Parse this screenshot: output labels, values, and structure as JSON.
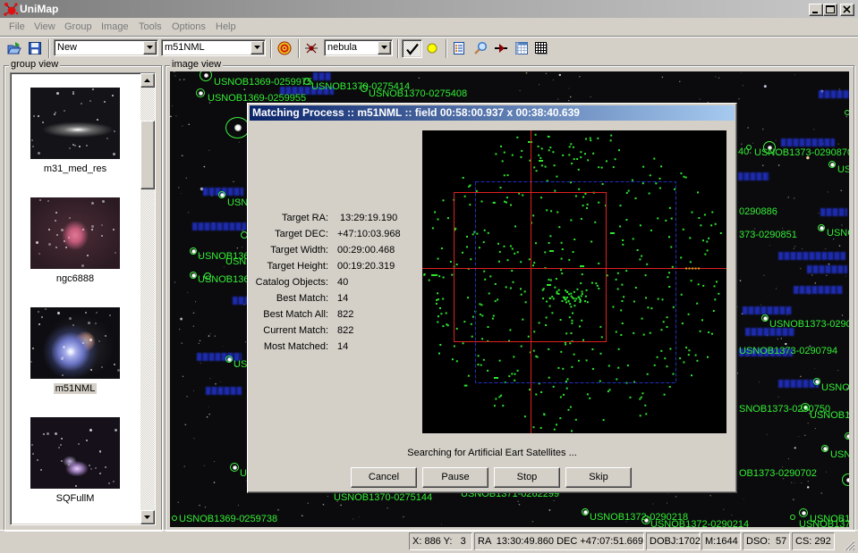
{
  "window": {
    "title": "UniMap",
    "icons": [
      "unimap-logo-icon",
      "minimize-icon",
      "maximize-icon",
      "close-icon"
    ]
  },
  "menu": {
    "items": [
      "File",
      "View",
      "Group",
      "Image",
      "Tools",
      "Options",
      "Help"
    ]
  },
  "toolbar": {
    "group_select": "New",
    "image_select": "m51NML",
    "object_type_select": "nebula",
    "icons": [
      "open-icon",
      "save-icon",
      "target-icon",
      "star-detect-icon",
      "check-icon",
      "yellow-circle-icon",
      "list-icon",
      "magnifier-icon",
      "pin-arrow-icon",
      "table-icon",
      "grid-icon"
    ]
  },
  "group_view": {
    "legend": "group view",
    "items": [
      {
        "label": "m31_med_res",
        "selected": false
      },
      {
        "label": "ngc6888",
        "selected": false
      },
      {
        "label": "m51NML",
        "selected": true
      },
      {
        "label": "SQFullM",
        "selected": false
      }
    ]
  },
  "image_view": {
    "legend": "image view",
    "catalog_labels": [
      "USNOB1369-0259975",
      "USNOB1369-0259955",
      "USNOB1370-0275414",
      "USNOB1370-0275408",
      "40",
      "USNOB1373-0290870",
      "USNO",
      "0290886",
      "373-0290851",
      "USNC",
      "USNOB1373-02908",
      "USNOB1373-0290794",
      "USNOB",
      "SNOB1373-0290750",
      "USNOB13",
      "USNC",
      "OB1373-0290702",
      "USNOB1370-0275144",
      "USNOB1371-0262299",
      "USNOB1369-0259738",
      "USNOB1372-0290218",
      "USNOB1372-0290214",
      "USNOB137",
      "USNOB1374",
      "USN",
      "USNOB136",
      "USN",
      "USNOB136",
      "USN",
      "U"
    ]
  },
  "dialog": {
    "title": "Matching Process :: m51NML :: field 00:58:00.937 x 00:38:40.639",
    "fields": [
      {
        "label": "Target RA:",
        "value": "13:29:19.190"
      },
      {
        "label": "Target DEC:",
        "value": "+47:10:03.968"
      },
      {
        "label": "Target Width:",
        "value": "00:29:00.468"
      },
      {
        "label": "Target Height:",
        "value": "00:19:20.319"
      },
      {
        "label": "Catalog Objects:",
        "value": "40"
      },
      {
        "label": "Best Match:",
        "value": "14"
      },
      {
        "label": "Best Match All:",
        "value": "822"
      },
      {
        "label": "Current Match:",
        "value": "822"
      },
      {
        "label": "Most Matched:",
        "value": "14"
      }
    ],
    "status": "Searching for Artificial Eart Satellites ...",
    "buttons": {
      "cancel": "Cancel",
      "pause": "Pause",
      "stop": "Stop",
      "skip": "Skip"
    }
  },
  "status_bar": {
    "xy": "X: 886 Y:   3",
    "radec": "RA  13:30:49.860 DEC +47:07:51.669",
    "dobj": "DOBJ:1702",
    "m": "M:1644",
    "dso": "DSO:  57",
    "cs": "CS: 292"
  },
  "colors": {
    "catalog_label": "#33ee33",
    "pgc_label": "#2234d6",
    "match_point": "#2ee62e",
    "crosshair": "#e02020",
    "search_box": "#2030c0",
    "dialog_title_start": "#0a246a",
    "dialog_title_end": "#a6caf0"
  }
}
